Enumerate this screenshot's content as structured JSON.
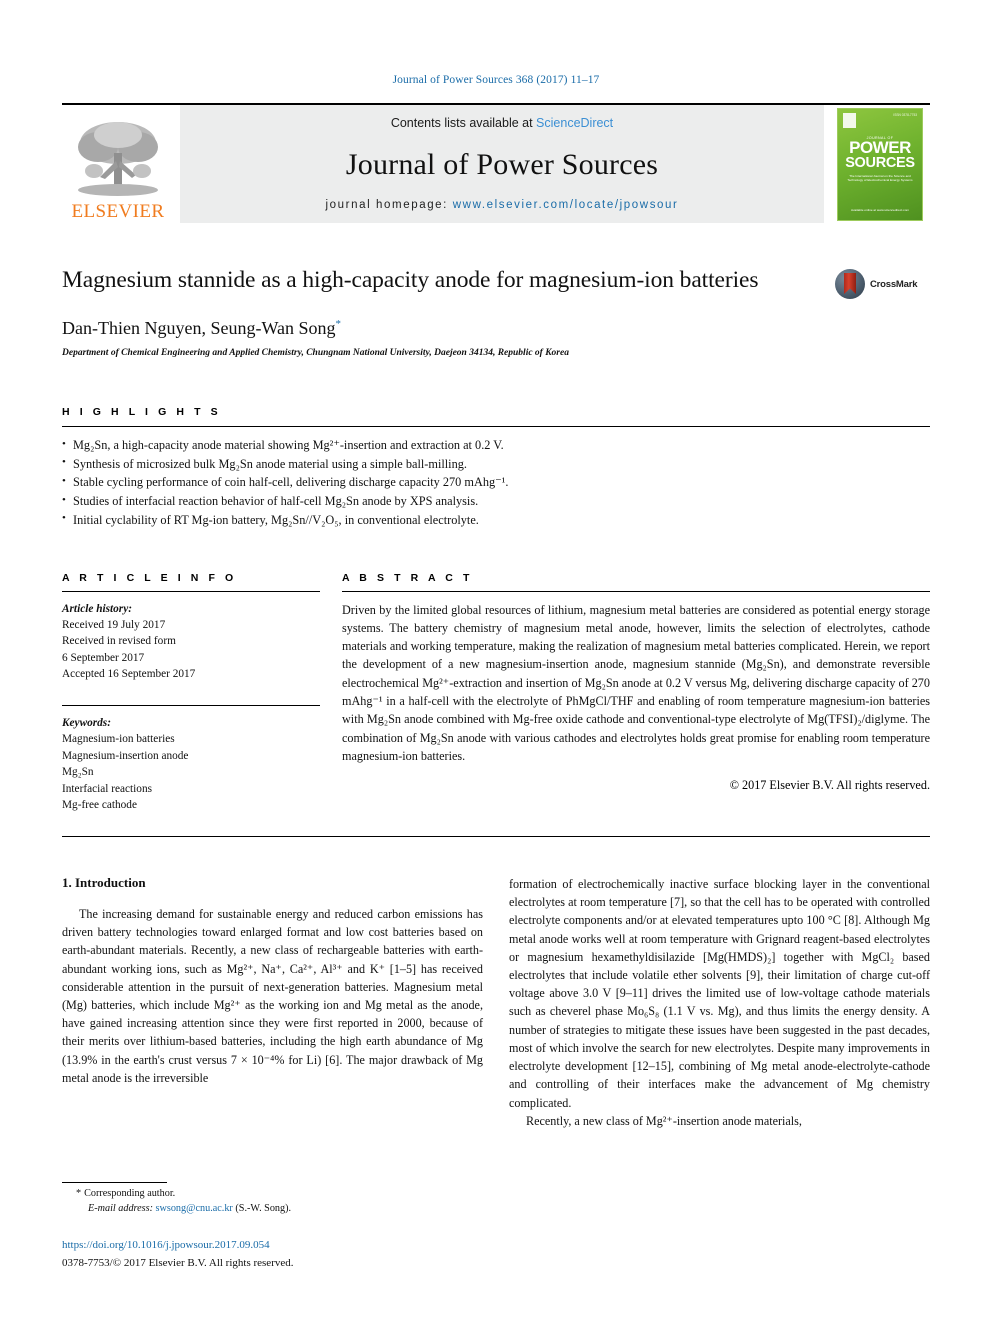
{
  "running_head": "Journal of Power Sources 368 (2017) 11–17",
  "masthead": {
    "publisher": "ELSEVIER",
    "contents_prefix": "Contents lists available at ",
    "contents_link": "ScienceDirect",
    "journal_title": "Journal of Power Sources",
    "homepage_prefix": "journal homepage: ",
    "homepage_url": "www.elsevier.com/locate/jpowsour",
    "cover": {
      "issn_corner": "ISSN 0378-7753",
      "kicker": "JOURNAL OF",
      "line1": "POWER",
      "line2": "SOURCES",
      "sub": "The International Journal on the Science and Technology of Electrochemical Energy Systems",
      "foot": "Available online at\nwww.sciencedirect.com"
    }
  },
  "article": {
    "title": "Magnesium stannide as a high-capacity anode for magnesium-ion batteries",
    "authors": "Dan-Thien Nguyen, Seung-Wan Song",
    "corresponding_marker": "*",
    "affiliation": "Department of Chemical Engineering and Applied Chemistry, Chungnam National University, Daejeon 34134, Republic of Korea",
    "crossmark_label": "CrossMark"
  },
  "highlights": {
    "heading": "H I G H L I G H T S",
    "items": [
      "Mg₂Sn, a high-capacity anode material showing Mg²⁺-insertion and extraction at 0.2 V.",
      "Synthesis of microsized bulk Mg₂Sn anode material using a simple ball-milling.",
      "Stable cycling performance of coin half-cell, delivering discharge capacity 270 mAhg⁻¹.",
      "Studies of interfacial reaction behavior of half-cell Mg₂Sn anode by XPS analysis.",
      "Initial cyclability of RT Mg-ion battery, Mg₂Sn//V₂O₅, in conventional electrolyte."
    ]
  },
  "article_info": {
    "heading": "A R T I C L E   I N F O",
    "history_label": "Article history:",
    "history": [
      "Received 19 July 2017",
      "Received in revised form",
      "6 September 2017",
      "Accepted 16 September 2017"
    ],
    "keywords_label": "Keywords:",
    "keywords": [
      "Magnesium-ion batteries",
      "Magnesium-insertion anode",
      "Mg₂Sn",
      "Interfacial reactions",
      "Mg-free cathode"
    ]
  },
  "abstract": {
    "heading": "A B S T R A C T",
    "text": "Driven by the limited global resources of lithium, magnesium metal batteries are considered as potential energy storage systems. The battery chemistry of magnesium metal anode, however, limits the selection of electrolytes, cathode materials and working temperature, making the realization of magnesium metal batteries complicated. Herein, we report the development of a new magnesium-insertion anode, magnesium stannide (Mg₂Sn), and demonstrate reversible electrochemical Mg²⁺-extraction and insertion of Mg₂Sn anode at 0.2 V versus Mg, delivering discharge capacity of 270 mAhg⁻¹ in a half-cell with the electrolyte of PhMgCl/THF and enabling of room temperature magnesium-ion batteries with Mg₂Sn anode combined with Mg-free oxide cathode and conventional-type electrolyte of Mg(TFSI)₂/diglyme. The combination of Mg₂Sn anode with various cathodes and electrolytes holds great promise for enabling room temperature magnesium-ion batteries.",
    "copyright": "© 2017 Elsevier B.V. All rights reserved."
  },
  "introduction": {
    "heading": "1. Introduction",
    "left_paragraph": "The increasing demand for sustainable energy and reduced carbon emissions has driven battery technologies toward enlarged format and low cost batteries based on earth-abundant materials. Recently, a new class of rechargeable batteries with earth-abundant working ions, such as Mg²⁺, Na⁺, Ca²⁺, Al³⁺ and K⁺ [1–5] has received considerable attention in the pursuit of next-generation batteries. Magnesium metal (Mg) batteries, which include Mg²⁺ as the working ion and Mg metal as the anode, have gained increasing attention since they were first reported in 2000, because of their merits over lithium-based batteries, including the high earth abundance of Mg (13.9% in the earth's crust versus 7 × 10⁻⁴% for Li) [6]. The major drawback of Mg metal anode is the irreversible",
    "right_paragraph": "formation of electrochemically inactive surface blocking layer in the conventional electrolytes at room temperature [7], so that the cell has to be operated with controlled electrolyte components and/or at elevated temperatures upto 100 °C [8]. Although Mg metal anode works well at room temperature with Grignard reagent-based electrolytes or magnesium hexamethyldisilazide [Mg(HMDS)₂] together with MgCl₂ based electrolytes that include volatile ether solvents [9], their limitation of charge cut-off voltage above 3.0 V [9–11] drives the limited use of low-voltage cathode materials such as cheverel phase Mo₆S₈ (1.1 V vs. Mg), and thus limits the energy density. A number of strategies to mitigate these issues have been suggested in the past decades, most of which involve the search for new electrolytes. Despite many improvements in electrolyte development [12–15], combining of Mg metal anode-electrolyte-cathode and controlling of their interfaces make the advancement of Mg chemistry complicated.",
    "right_paragraph2": "Recently, a new class of Mg²⁺-insertion anode materials,"
  },
  "footer": {
    "corresponding_star": "*",
    "corresponding_text": "Corresponding author.",
    "email_label": "E-mail address:",
    "email": "swsong@cnu.ac.kr",
    "email_suffix": "(S.-W. Song).",
    "doi": "https://doi.org/10.1016/j.jpowsour.2017.09.054",
    "issn_copyright": "0378-7753/© 2017 Elsevier B.V. All rights reserved."
  },
  "colors": {
    "link_blue": "#1a6ca8",
    "sciencedirect_blue": "#3b8fd4",
    "elsevier_orange": "#f07c1f",
    "cover_green": "#6fb22e",
    "crossmark_red": "#c0301f"
  }
}
